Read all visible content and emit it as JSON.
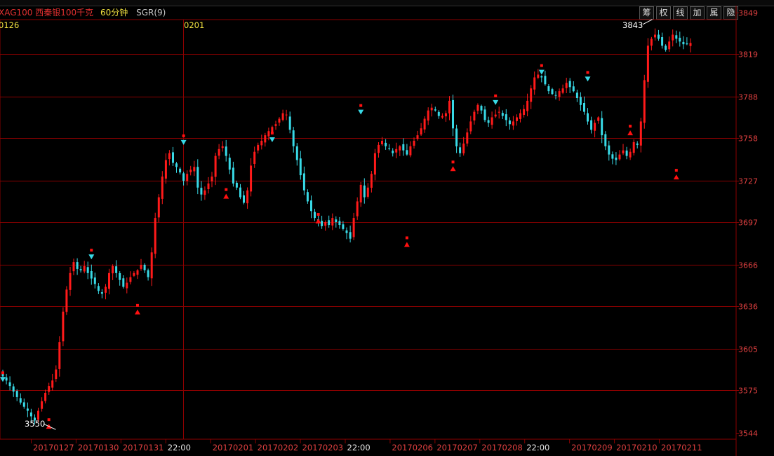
{
  "header": {
    "symbol": "XAG100 西秦银100千克",
    "interval": "60分钟",
    "indicator": "SGR(9)"
  },
  "toolbar": {
    "buttons": [
      "筹",
      "权",
      "线",
      "加",
      "属",
      "隐"
    ]
  },
  "colors": {
    "background": "#000000",
    "up": "#ff1a1a",
    "down": "#38d9e6",
    "grid": "#8b0000",
    "axis_text": "#e04040",
    "date_text": "#e04040",
    "time_text": "#e8e8e8",
    "session_text": "#f0e040",
    "marker_buy": "#ff1010",
    "marker_sell": "#38d9e6"
  },
  "chart_data": {
    "type": "candlestick",
    "y_ticks": [
      3849,
      3819,
      3788,
      3758,
      3727,
      3697,
      3666,
      3636,
      3605,
      3575,
      3544
    ],
    "ylim": [
      3544,
      3849
    ],
    "x_labels": [
      "20170127",
      "20170130",
      "20170131",
      "22:00",
      "20170201",
      "20170202",
      "20170203",
      "22:00",
      "20170206",
      "20170207",
      "20170208",
      "22:00",
      "20170209",
      "20170210",
      "20170211"
    ],
    "session_labels": [
      "0126",
      "0201"
    ],
    "annotations": [
      {
        "text": "3843",
        "kind": "high"
      },
      {
        "text": "3550",
        "kind": "low"
      }
    ],
    "signals": [
      {
        "type": "sell",
        "price": 3583
      },
      {
        "type": "buy",
        "price": 3549
      },
      {
        "type": "sell",
        "price": 3672
      },
      {
        "type": "buy",
        "price": 3632
      },
      {
        "type": "sell",
        "price": 3755
      },
      {
        "type": "buy",
        "price": 3716
      },
      {
        "type": "sell",
        "price": 3757
      },
      {
        "type": "buy",
        "price": 3698
      },
      {
        "type": "sell",
        "price": 3777
      },
      {
        "type": "buy",
        "price": 3681
      },
      {
        "type": "buy",
        "price": 3736
      },
      {
        "type": "sell",
        "price": 3784
      },
      {
        "type": "sell",
        "price": 3806
      },
      {
        "type": "sell",
        "price": 3801
      },
      {
        "type": "buy",
        "price": 3762
      },
      {
        "type": "buy",
        "price": 3730
      }
    ],
    "close_path": [
      3585,
      3582,
      3578,
      3574,
      3570,
      3566,
      3563,
      3560,
      3556,
      3553,
      3560,
      3567,
      3573,
      3578,
      3582,
      3590,
      3610,
      3632,
      3648,
      3660,
      3668,
      3663,
      3662,
      3665,
      3660,
      3656,
      3652,
      3647,
      3645,
      3650,
      3660,
      3665,
      3660,
      3655,
      3650,
      3653,
      3657,
      3660,
      3662,
      3666,
      3662,
      3657,
      3675,
      3700,
      3715,
      3730,
      3742,
      3747,
      3740,
      3737,
      3733,
      3727,
      3732,
      3735,
      3737,
      3722,
      3717,
      3720,
      3725,
      3730,
      3745,
      3750,
      3752,
      3745,
      3735,
      3725,
      3722,
      3715,
      3711,
      3720,
      3738,
      3748,
      3753,
      3756,
      3760,
      3763,
      3766,
      3768,
      3772,
      3776,
      3775,
      3764,
      3752,
      3742,
      3731,
      3720,
      3712,
      3705,
      3700,
      3697,
      3694,
      3697,
      3695,
      3700,
      3697,
      3695,
      3692,
      3689,
      3685,
      3700,
      3712,
      3724,
      3715,
      3722,
      3732,
      3747,
      3753,
      3756,
      3752,
      3750,
      3747,
      3750,
      3752,
      3749,
      3746,
      3752,
      3756,
      3760,
      3765,
      3772,
      3778,
      3780,
      3778,
      3774,
      3774,
      3776,
      3785,
      3765,
      3752,
      3747,
      3754,
      3762,
      3770,
      3777,
      3782,
      3778,
      3771,
      3769,
      3773,
      3775,
      3777,
      3774,
      3771,
      3768,
      3770,
      3773,
      3776,
      3779,
      3785,
      3794,
      3802,
      3804,
      3802,
      3797,
      3792,
      3790,
      3789,
      3792,
      3794,
      3798,
      3795,
      3792,
      3787,
      3782,
      3777,
      3770,
      3764,
      3769,
      3773,
      3760,
      3752,
      3746,
      3743,
      3742,
      3746,
      3749,
      3745,
      3748,
      3755,
      3753,
      3770,
      3800,
      3825,
      3830,
      3833,
      3830,
      3825,
      3822,
      3828,
      3833,
      3830,
      3828,
      3826,
      3826,
      3827
    ]
  }
}
